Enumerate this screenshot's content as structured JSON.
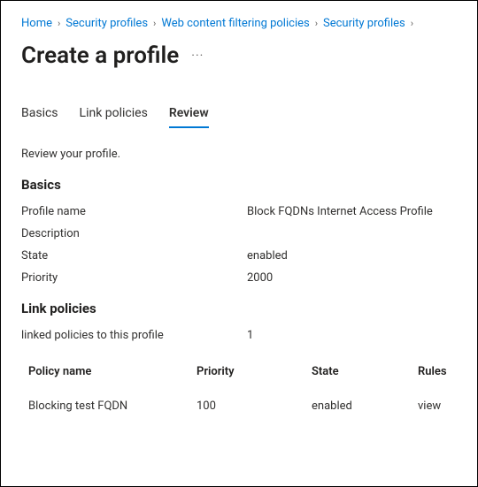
{
  "breadcrumb": [
    {
      "label": "Home"
    },
    {
      "label": "Security profiles"
    },
    {
      "label": "Web content filtering policies"
    },
    {
      "label": "Security profiles"
    }
  ],
  "title": "Create a profile",
  "tabs": {
    "basics": "Basics",
    "link_policies": "Link policies",
    "review": "Review"
  },
  "subtext": "Review your profile.",
  "sections": {
    "basics": {
      "heading": "Basics",
      "profile_name_label": "Profile name",
      "profile_name_value": "Block FQDNs Internet Access Profile",
      "description_label": "Description",
      "description_value": "",
      "state_label": "State",
      "state_value": "enabled",
      "priority_label": "Priority",
      "priority_value": "2000"
    },
    "link_policies": {
      "heading": "Link policies",
      "linked_count_label": "linked policies to this profile",
      "linked_count_value": "1",
      "columns": {
        "policy_name": "Policy name",
        "priority": "Priority",
        "state": "State",
        "rules": "Rules"
      },
      "rows": [
        {
          "policy_name": "Blocking test FQDN",
          "priority": "100",
          "state": "enabled",
          "rules": "view"
        }
      ]
    }
  }
}
